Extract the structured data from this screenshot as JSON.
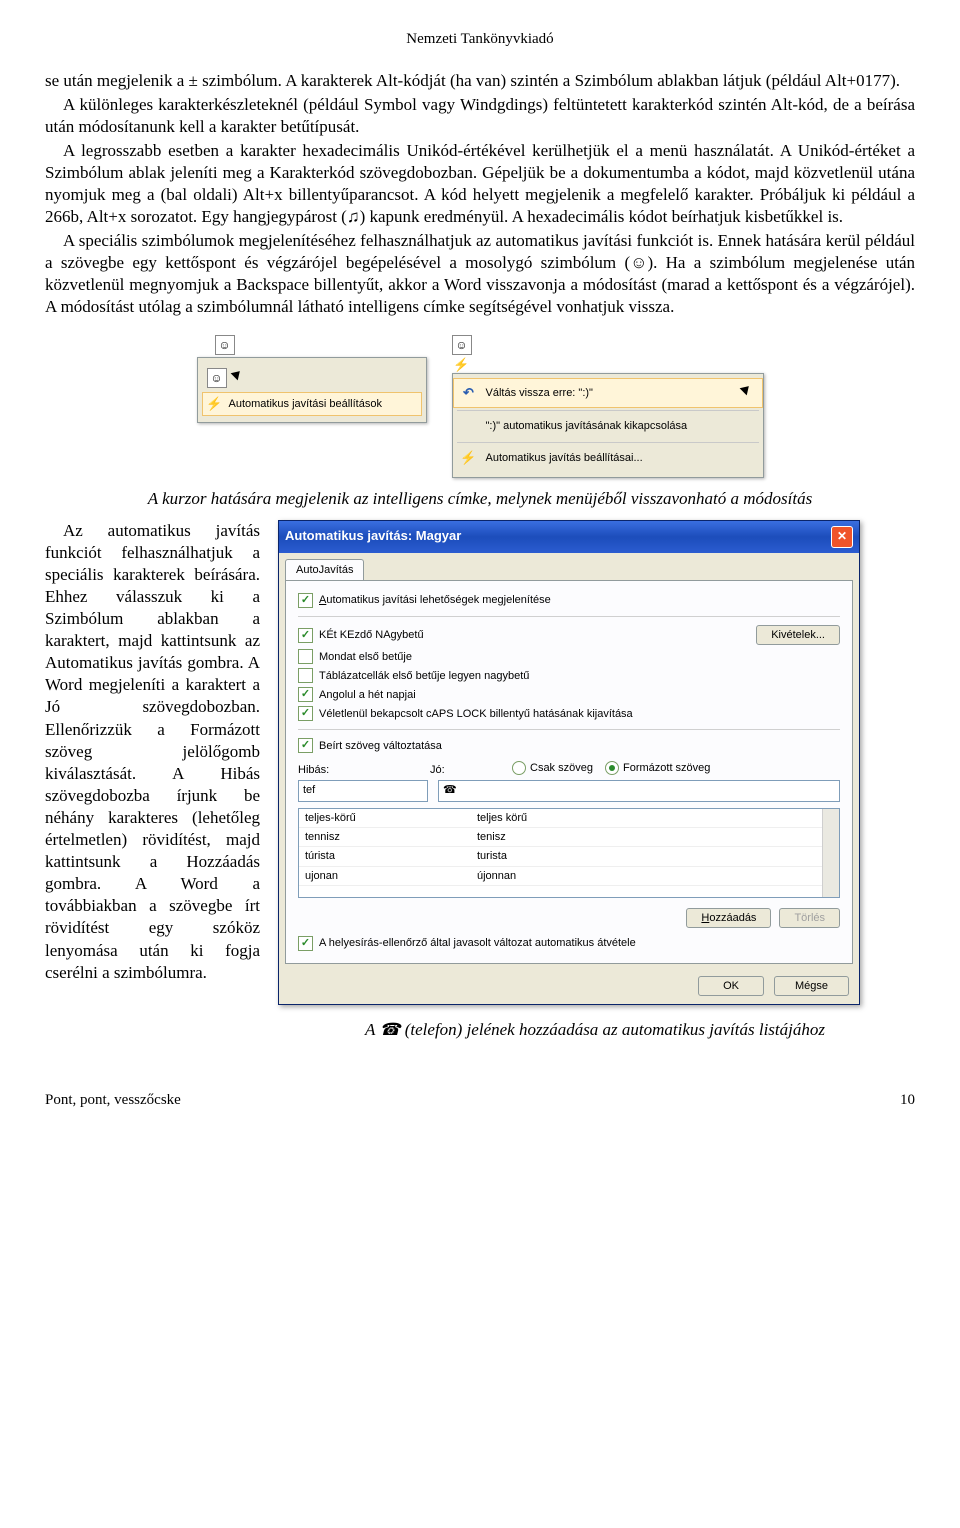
{
  "header": "Nemzeti Tankönyvkiadó",
  "para1": "se után megjelenik a ± szimbólum. A karakterek Alt-kódját (ha van) szintén a Szimbólum ablakban látjuk (például Alt+0177).",
  "para2": "A különleges karakterkészleteknél (például Symbol vagy Windgdings) feltüntetett karakterkód szintén Alt-kód, de a beírása után módosítanunk kell a karakter betűtípusát.",
  "para3": "A legrosszabb esetben a karakter hexadecimális Unikód-értékével kerülhetjük el a menü használatát. A Unikód-értéket a Szimbólum ablak jeleníti meg a Karakterkód szövegdobozban. Gépeljük be a dokumentumba a kódot, majd közvetlenül utána nyomjuk meg a (bal oldali) Alt+x billentyűparancsot. A kód helyett megjelenik a megfelelő karakter. Próbáljuk ki például a 266b, Alt+x sorozatot. Egy hangjegypárost (♫) kapunk eredményül. A hexadecimális kódot beírhatjuk kisbetűkkel is.",
  "para4": "A speciális szimbólumok megjelenítéséhez felhasználhatjuk az automatikus javítási funkciót is. Ennek hatására kerül például a szövegbe egy kettőspont és végzárójel begépelésével a mosolygó szimbólum (☺). Ha a szimbólum megjelenése után közvetlenül megnyomjuk a Backspace billentyűt, akkor a Word visszavonja a módosítást (marad a kettőspont és a végzárójel). A módosítást utólag a szimbólumnál látható intelligens címke segítségével vonhatjuk vissza.",
  "smarttag_left": {
    "item": "Automatikus javítási beállítások"
  },
  "smarttag_right": {
    "undo": "Váltás vissza erre: \":)\"",
    "off": "\":)\" automatikus javításának kikapcsolása",
    "settings": "Automatikus javítás beállításai..."
  },
  "caption1": "A kurzor hatására megjelenik az intelligens címke, melynek menüjéből visszavonható a módosítás",
  "para5": "Az automatikus javítás funkciót felhasználhatjuk a speciális karakterek beírására. Ehhez válasszuk ki a Szimbólum ablakban a karaktert, majd kattintsunk az Automatikus javítás gombra. A Word megjeleníti a karaktert a Jó szövegdobozban. Ellenőrizzük a Formázott szöveg jelölőgomb kiválasztását. A Hibás szövegdobozba írjunk be néhány karakteres (lehetőleg értelmetlen) rövidítést, majd kattintsunk a Hozzáadás gombra. A Word a továbbiakban a szövegbe írt rövidítést egy szóköz lenyomása után ki fogja cserélni a szimbólumra.",
  "dialog": {
    "title": "Automatikus javítás: Magyar",
    "tab": "AutoJavítás",
    "chk1": "Automatikus javítási lehetőségek megjelenítése",
    "chk2": "KÉt KEzdő NAgybetű",
    "chk3": "Mondat első betűje",
    "chk4": "Táblázatcellák első betűje legyen nagybetű",
    "chk5": "Angolul a hét napjai",
    "chk6": "Véletlenül bekapcsolt cAPS LOCK billentyű hatásának kijavítása",
    "chk7": "Beírt szöveg változtatása",
    "kivetelek": "Kivételek...",
    "hibas_label": "Hibás:",
    "jo_label": "Jó:",
    "radio1": "Csak szöveg",
    "radio2": "Formázott szöveg",
    "hibas_value": "tef",
    "jo_value": "☎",
    "list": [
      {
        "a": "teljes-körű",
        "b": "teljes körű"
      },
      {
        "a": "tennisz",
        "b": "tenisz"
      },
      {
        "a": "túrista",
        "b": "turista"
      },
      {
        "a": "ujonan",
        "b": "újonnan"
      }
    ],
    "hozzaadas": "Hozzáadás",
    "torles": "Törlés",
    "chk8": "A helyesírás-ellenőrző által javasolt változat automatikus átvétele",
    "ok": "OK",
    "megse": "Mégse"
  },
  "caption2": "A ☎ (telefon) jelének hozzáadása az automatikus javítás listájához",
  "footer": {
    "left": "Pont, pont, vesszőcske",
    "right": "10"
  }
}
